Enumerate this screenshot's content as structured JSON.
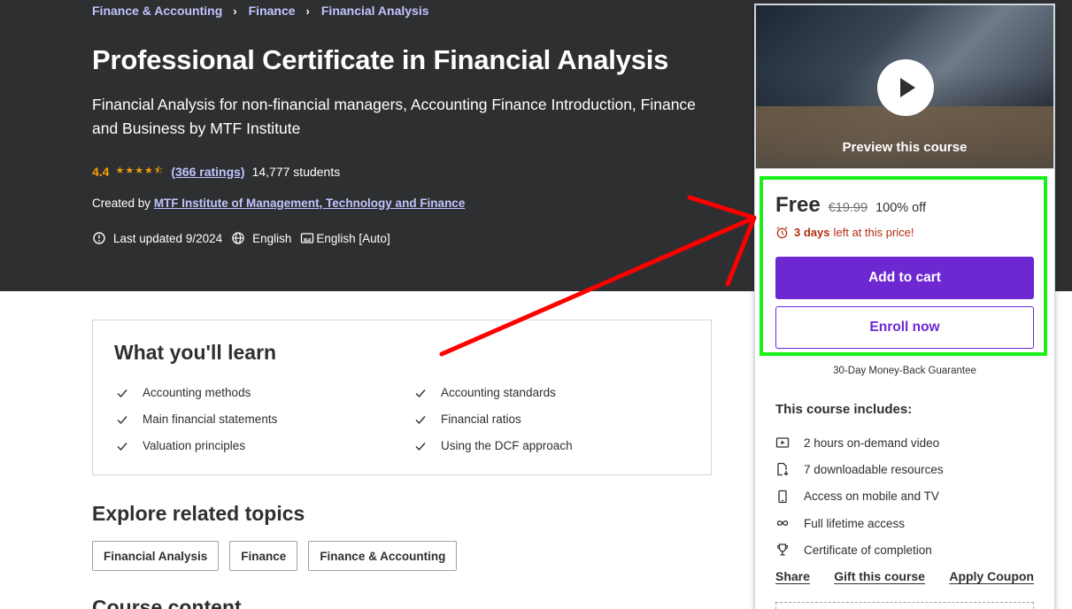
{
  "breadcrumb": [
    "Finance & Accounting",
    "Finance",
    "Financial Analysis"
  ],
  "course": {
    "title": "Professional Certificate in Financial Analysis",
    "subtitle": "Financial Analysis for non-financial managers, Accounting Finance Introduction, Finance and Business by MTF Institute",
    "rating": "4.4",
    "stars": "★★★★⯪",
    "ratings_count": "(366 ratings)",
    "students": "14,777 students",
    "created_by_prefix": "Created by",
    "author": "MTF Institute of Management, Technology and Finance",
    "last_updated": "Last updated 9/2024",
    "language": "English",
    "captions": "English [Auto]"
  },
  "sidebar": {
    "preview_label": "Preview this course",
    "price": "Free",
    "original_price": "€19.99",
    "discount": "100% off",
    "deadline_bold": "3 days",
    "deadline_rest": "left at this price!",
    "add_to_cart": "Add to cart",
    "enroll_now": "Enroll now",
    "guarantee": "30-Day Money-Back Guarantee",
    "includes_title": "This course includes:",
    "includes": [
      {
        "icon": "video-icon",
        "label": "2 hours on-demand video"
      },
      {
        "icon": "file-download-icon",
        "label": "7 downloadable resources"
      },
      {
        "icon": "mobile-icon",
        "label": "Access on mobile and TV"
      },
      {
        "icon": "infinity-icon",
        "label": "Full lifetime access"
      },
      {
        "icon": "trophy-icon",
        "label": "Certificate of completion"
      }
    ],
    "share": "Share",
    "gift": "Gift this course",
    "coupon": "Apply Coupon"
  },
  "learn": {
    "title": "What you'll learn",
    "items": [
      "Accounting methods",
      "Accounting standards",
      "Main financial statements",
      "Financial ratios",
      "Valuation principles",
      "Using the DCF approach"
    ]
  },
  "explore": {
    "title": "Explore related topics",
    "topics": [
      "Financial Analysis",
      "Finance",
      "Finance & Accounting"
    ]
  },
  "content_title": "Course content",
  "colors": {
    "hero_bg": "#2d2f31",
    "accent_purple": "#6d28d2",
    "rating_orange": "#f69c08",
    "link_lavender": "#c0c4fc",
    "deadline_red": "#b32d0f",
    "annotation_red": "#ff0000",
    "annotation_green": "#18f018"
  }
}
